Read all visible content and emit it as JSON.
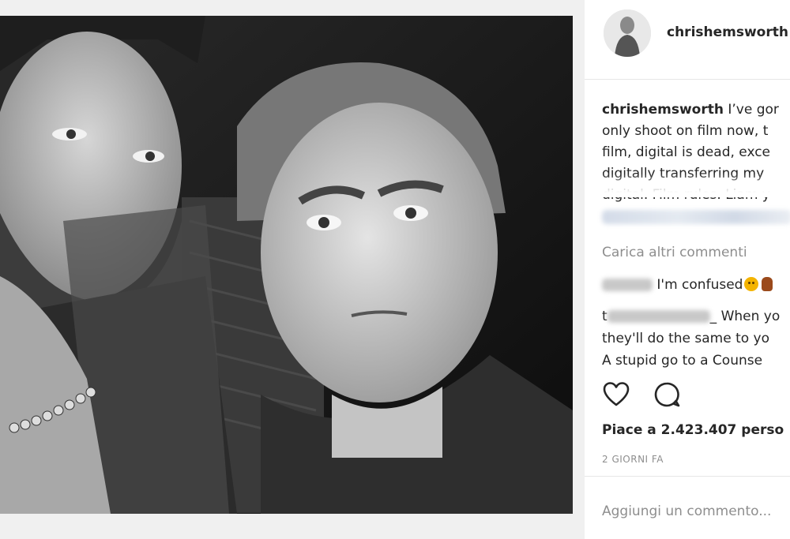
{
  "post": {
    "image_alt": "Black and white selfie of two men",
    "colors": {
      "background": "#f0f0f0",
      "panel": "#ffffff",
      "text": "#262626",
      "muted": "#8e8e8e",
      "divider": "#e6e6e6"
    }
  },
  "header": {
    "username": "chrishemsworth"
  },
  "caption": {
    "username": "chrishemsworth",
    "line1_text": " I’ve gor",
    "line2": "only shoot on film now, t",
    "line3": "film, digital is dead, exce",
    "line4": "digitally transferring my",
    "line5": "digital. Film rules. Liam y"
  },
  "comments": {
    "load_more": "Carica altri commenti",
    "items": [
      {
        "text": "I'm confused"
      },
      {
        "prefix": "t",
        "text": "_ When yo"
      }
    ],
    "continuation_1": "they'll do the same to yo",
    "continuation_2": "A stupid go to a Counse"
  },
  "actions": {
    "like_icon": "heart-outline-icon",
    "comment_icon": "speech-bubble-icon"
  },
  "likes": {
    "text": "Piace a 2.423.407 perso"
  },
  "timestamp": {
    "text": "2 GIORNI FA"
  },
  "add_comment": {
    "placeholder": "Aggiungi un commento..."
  }
}
